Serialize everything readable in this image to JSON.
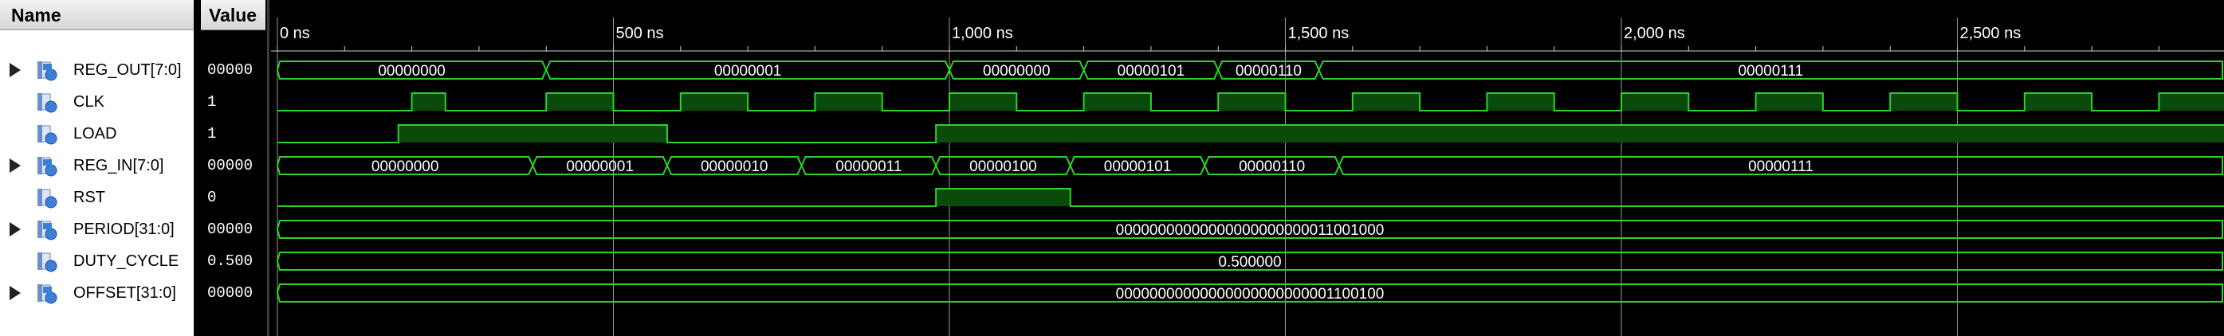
{
  "columns": {
    "name": "Name",
    "value": "Value"
  },
  "time_axis": {
    "unit_label_suffix": "ns",
    "ticks": [
      {
        "t": 0,
        "label": "0 ns"
      },
      {
        "t": 500,
        "label": "500 ns"
      },
      {
        "t": 1000,
        "label": "1,000 ns"
      },
      {
        "t": 1500,
        "label": "1,500 ns"
      },
      {
        "t": 2000,
        "label": "2,000 ns"
      },
      {
        "t": 2500,
        "label": "2,500 ns"
      }
    ],
    "t_max": 2900
  },
  "signals": [
    {
      "name": "REG_OUT[7:0]",
      "value": "00000",
      "type": "bus",
      "expandable": true,
      "icon": "bus-signal-icon",
      "segments": [
        {
          "start": 0,
          "end": 400,
          "label": "00000000"
        },
        {
          "start": 400,
          "end": 1000,
          "label": "00000001"
        },
        {
          "start": 1000,
          "end": 1200,
          "label": "00000000"
        },
        {
          "start": 1200,
          "end": 1400,
          "label": "00000101"
        },
        {
          "start": 1400,
          "end": 1550,
          "label": "00000110"
        },
        {
          "start": 1550,
          "end": 2900,
          "label": "00000111"
        }
      ]
    },
    {
      "name": "CLK",
      "value": "1",
      "type": "bit",
      "expandable": false,
      "icon": "bit-signal-icon",
      "edges": [
        [
          0,
          0
        ],
        [
          200,
          1
        ],
        [
          250,
          0
        ],
        [
          400,
          1
        ],
        [
          500,
          0
        ],
        [
          600,
          1
        ],
        [
          700,
          0
        ],
        [
          800,
          1
        ],
        [
          900,
          0
        ],
        [
          1000,
          1
        ],
        [
          1100,
          0
        ],
        [
          1200,
          1
        ],
        [
          1300,
          0
        ],
        [
          1400,
          1
        ],
        [
          1500,
          0
        ],
        [
          1600,
          1
        ],
        [
          1700,
          0
        ],
        [
          1800,
          1
        ],
        [
          1900,
          0
        ],
        [
          2000,
          1
        ],
        [
          2100,
          0
        ],
        [
          2200,
          1
        ],
        [
          2300,
          0
        ],
        [
          2400,
          1
        ],
        [
          2500,
          0
        ],
        [
          2600,
          1
        ],
        [
          2700,
          0
        ],
        [
          2800,
          1
        ]
      ]
    },
    {
      "name": "LOAD",
      "value": "1",
      "type": "bit",
      "expandable": false,
      "icon": "bit-signal-icon",
      "edges": [
        [
          0,
          0
        ],
        [
          180,
          1
        ],
        [
          580,
          0
        ],
        [
          980,
          1
        ]
      ]
    },
    {
      "name": "REG_IN[7:0]",
      "value": "00000",
      "type": "bus",
      "expandable": true,
      "icon": "bus-signal-icon",
      "segments": [
        {
          "start": 0,
          "end": 380,
          "label": "00000000"
        },
        {
          "start": 380,
          "end": 580,
          "label": "00000001"
        },
        {
          "start": 580,
          "end": 780,
          "label": "00000010"
        },
        {
          "start": 780,
          "end": 980,
          "label": "00000011"
        },
        {
          "start": 980,
          "end": 1180,
          "label": "00000100"
        },
        {
          "start": 1180,
          "end": 1380,
          "label": "00000101"
        },
        {
          "start": 1380,
          "end": 1580,
          "label": "00000110"
        },
        {
          "start": 1580,
          "end": 2900,
          "label": "00000111"
        }
      ]
    },
    {
      "name": "RST",
      "value": "0",
      "type": "bit",
      "expandable": false,
      "icon": "bit-signal-icon",
      "edges": [
        [
          0,
          0
        ],
        [
          980,
          1
        ],
        [
          1180,
          0
        ]
      ]
    },
    {
      "name": "PERIOD[31:0]",
      "value": "00000",
      "type": "bus",
      "expandable": true,
      "icon": "bus-signal-icon",
      "segments": [
        {
          "start": 0,
          "end": 2900,
          "label": "00000000000000000000000011001000"
        }
      ]
    },
    {
      "name": "DUTY_CYCLE",
      "value": "0.500",
      "type": "bus",
      "expandable": false,
      "icon": "real-signal-icon",
      "segments": [
        {
          "start": 0,
          "end": 2900,
          "label": "0.500000"
        }
      ]
    },
    {
      "name": "OFFSET[31:0]",
      "value": "00000",
      "type": "bus",
      "expandable": true,
      "icon": "bus-signal-icon",
      "segments": [
        {
          "start": 0,
          "end": 2900,
          "label": "00000000000000000000000001100100"
        }
      ]
    }
  ],
  "colors": {
    "wave": "#2ad42a",
    "wave_fill": "#0c4a0c",
    "grid": "#9a9a9a",
    "ruler_text": "#ffffff",
    "bus_text": "#ffffff"
  }
}
